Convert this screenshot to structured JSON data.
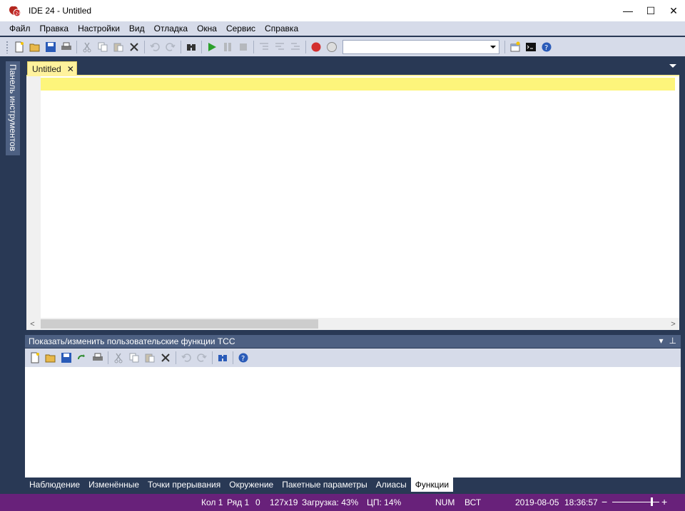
{
  "window": {
    "title": "IDE 24 - Untitled",
    "controls": [
      "—",
      "☐",
      "✕"
    ]
  },
  "menu": [
    "Файл",
    "Правка",
    "Настройки",
    "Вид",
    "Отладка",
    "Окна",
    "Сервис",
    "Справка"
  ],
  "toolbar": {
    "combo_value": ""
  },
  "toolbox": {
    "label": "Панель инструментов"
  },
  "document": {
    "tab_label": "Untitled",
    "tab_close": "✕"
  },
  "editor": {
    "scroll_left": "<",
    "scroll_right": ">"
  },
  "panel": {
    "title": "Показать/изменить пользовательские функции TCC",
    "dropdown": "▾",
    "pin": "⊥"
  },
  "bottom_tabs": [
    "Наблюдение",
    "Изменённые",
    "Точки прерывания",
    "Окружение",
    "Пакетные параметры",
    "Алиасы",
    "Функции"
  ],
  "status": {
    "col": "Кол 1",
    "row": "Ряд 1",
    "zero": "0",
    "size": "127x19",
    "load": "Загрузка: 43%",
    "cpu": "ЦП: 14%",
    "num": "NUM",
    "ins": "ВСТ",
    "date": "2019-08-05",
    "time": "18:36:57",
    "zoom_minus": "−",
    "zoom_plus": "+"
  },
  "colors": {
    "accent": "#68217a",
    "tab_active": "#fff29d",
    "current_line": "#fdf57b",
    "chrome": "#293955",
    "toolbar": "#d6dbe9"
  }
}
